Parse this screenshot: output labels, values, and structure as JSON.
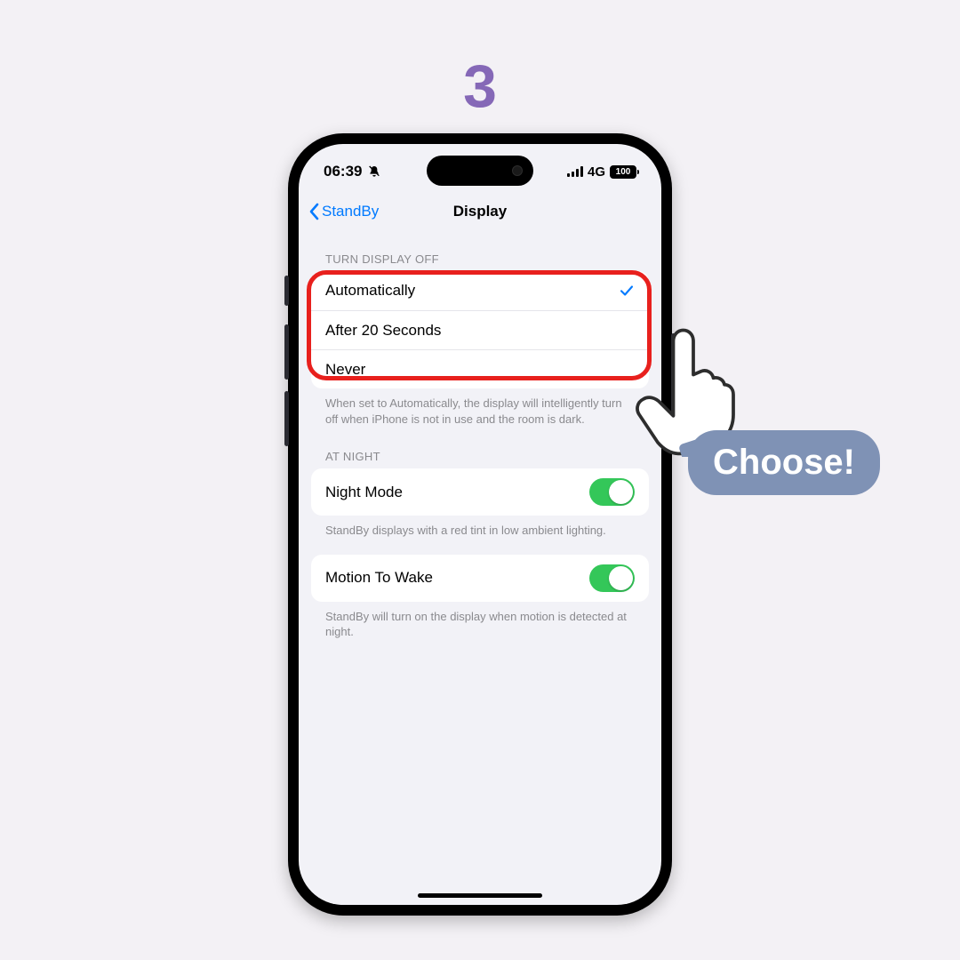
{
  "step": "3",
  "callout": "Choose!",
  "status": {
    "time": "06:39",
    "network": "4G",
    "battery": "100"
  },
  "nav": {
    "back": "StandBy",
    "title": "Display"
  },
  "turnOff": {
    "header": "TURN DISPLAY OFF",
    "options": [
      "Automatically",
      "After 20 Seconds",
      "Never"
    ],
    "selected": 0,
    "footer": "When set to Automatically, the display will intelligently turn off when iPhone is not in use and the room is dark."
  },
  "atNight": {
    "header": "AT NIGHT",
    "nightMode": {
      "label": "Night Mode",
      "on": true,
      "footer": "StandBy displays with a red tint in low ambient lighting."
    },
    "motion": {
      "label": "Motion To Wake",
      "on": true,
      "footer": "StandBy will turn on the display when motion is detected at night."
    }
  }
}
